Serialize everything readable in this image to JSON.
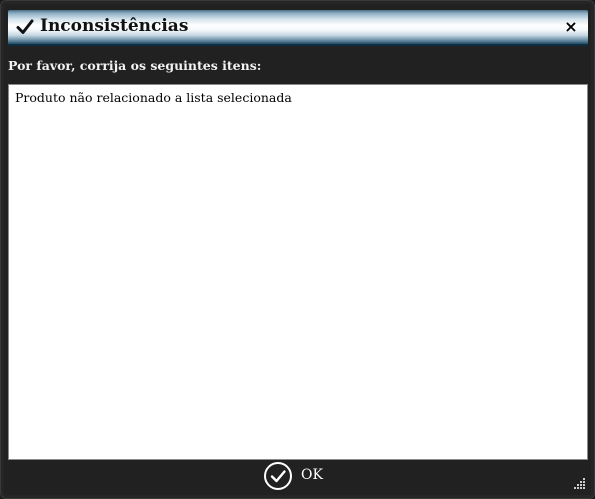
{
  "dialog": {
    "title": "Inconsistências",
    "title_icon": "check-icon",
    "close_icon": "close-icon",
    "close_label": "×",
    "instruction": "Por favor, corrija os seguintes itens:",
    "messages": [
      "Produto não relacionado a lista selecionada"
    ],
    "ok_label": "OK",
    "ok_icon": "circle-check-icon"
  },
  "colors": {
    "dialog_bg": "#212121",
    "title_gradient_mid": "#ffffff",
    "title_gradient_edge": "#234a63",
    "text_light": "#f2f2f2",
    "message_bg": "#ffffff"
  }
}
